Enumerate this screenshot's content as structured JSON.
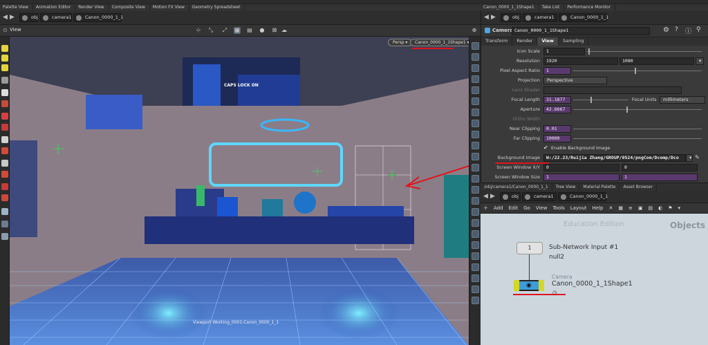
{
  "top_shelf": {
    "left_tabs": [
      "Palette View",
      "Animation Editor",
      "Render View",
      "Composite View",
      "Motion FX View",
      "Geometry Spreadsheet"
    ],
    "right_tabs": [
      "Canon_0000_1_1Shape1",
      "Take List",
      "Performance Monitor"
    ]
  },
  "viewport_path": {
    "network": "obj",
    "node": "camera1",
    "camera": "Canon_0000_1_1"
  },
  "viewport": {
    "title": "View",
    "persp_label": "Persp",
    "camera_menu_label": "Canon_0000_1_1Shape1",
    "caps_lock": "CAPS LOCK ON",
    "caption": "Viewport Working_0001:Canon_0000_1_1"
  },
  "params": {
    "path": {
      "network": "obj",
      "node": "camera1",
      "camera": "Canon_0000_1_1"
    },
    "node_type": "Camera",
    "node_name": "Canon_0000_1_1Shape1",
    "tabs": [
      "Transform",
      "Render",
      "View",
      "Sampling"
    ],
    "active_tab": "View",
    "rows": {
      "icon_scale": {
        "label": "Icon Scale",
        "value": "1"
      },
      "resolution": {
        "label": "Resolution",
        "x": "1920",
        "y": "1080"
      },
      "pixel_aspect": {
        "label": "Pixel Aspect Ratio",
        "value": "1"
      },
      "projection": {
        "label": "Projection",
        "value": "Perspective"
      },
      "lens_shader": {
        "label": "Lens Shader"
      },
      "focal_length": {
        "label": "Focal Length",
        "value": "31.1877",
        "units_label": "Focal Units",
        "units_value": "millimeters"
      },
      "aperture": {
        "label": "Aperture",
        "value": "42.6667"
      },
      "ortho_width": {
        "label": "Ortho Width"
      },
      "near_clip": {
        "label": "Near Clipping",
        "value": "0.01"
      },
      "far_clip": {
        "label": "Far Clipping",
        "value": "10000"
      },
      "enable_bg": {
        "label": "Enable Background Image"
      },
      "bg_image": {
        "label": "Background Image",
        "value": "W:/22.23/Ruijia Zhang/GROUP/0524/pngCom/Dcomp/Dco"
      },
      "screen_window_xy": {
        "label": "Screen Window X/Y",
        "x": "0",
        "y": "0"
      },
      "screen_window_size": {
        "label": "Screen Window Size",
        "x": "1",
        "y": "1"
      }
    }
  },
  "network": {
    "tabs": [
      "/obj/camera1/Canon_0000_1_1",
      "Tree View",
      "Material Palette",
      "Asset Browser"
    ],
    "path": {
      "network": "obj",
      "node": "camera1",
      "camera": "Canon_0000_1_1"
    },
    "menu": [
      "Add",
      "Edit",
      "Go",
      "View",
      "Tools",
      "Layout",
      "Help"
    ],
    "watermark": "Education Edition",
    "context_label": "Objects",
    "input_node": {
      "index": "1",
      "name": "Sub-Network Input #1",
      "sub": "null2"
    },
    "camera_node": {
      "type": "Camera",
      "name": "Canon_0000_1_1Shape1"
    }
  },
  "colors": {
    "accent_red": "#e0141e",
    "purple_field": "#5a3a6e",
    "network_bg": "#cdd6dd",
    "camera_node": "#3e9dd9",
    "node_flag": "#d4d824"
  }
}
